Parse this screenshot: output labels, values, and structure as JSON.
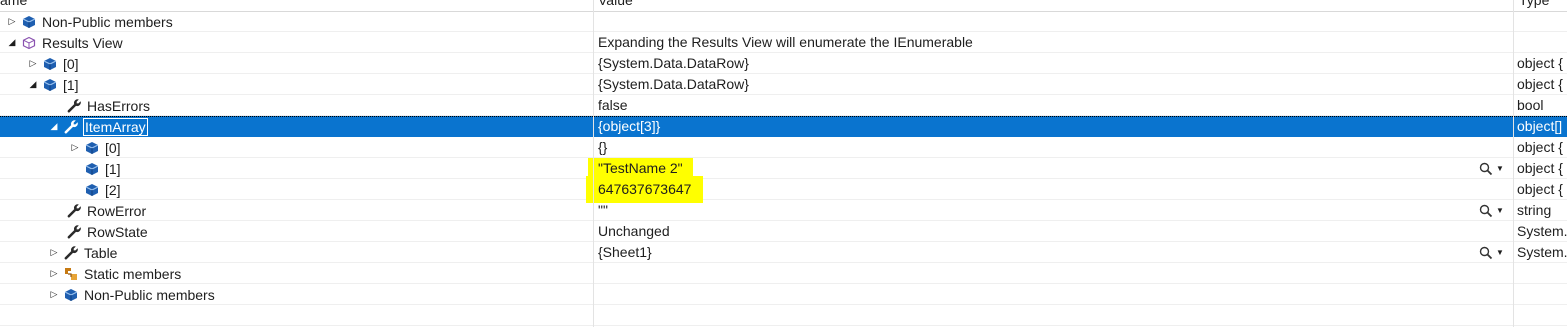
{
  "columns": {
    "name": "ame",
    "value": "Value",
    "type": "Type"
  },
  "rows": [
    {
      "label": "Non-Public members",
      "value": "",
      "type": ""
    },
    {
      "label": "Results View",
      "value": "Expanding the Results View will enumerate the IEnumerable",
      "type": ""
    },
    {
      "label": "[0]",
      "value": "{System.Data.DataRow}",
      "type": "object {"
    },
    {
      "label": "[1]",
      "value": "{System.Data.DataRow}",
      "type": "object {"
    },
    {
      "label": "HasErrors",
      "value": "false",
      "type": "bool"
    },
    {
      "label": "ItemArray",
      "value": "{object[3]}",
      "type": "object[]"
    },
    {
      "label": "[0]",
      "value": "{}",
      "type": "object {"
    },
    {
      "label": "[1]",
      "value": "\"TestName 2\"",
      "type": "object {"
    },
    {
      "label": "[2]",
      "value": "647637673647",
      "type": "object {"
    },
    {
      "label": "RowError",
      "value": "\"\"",
      "type": "string"
    },
    {
      "label": "RowState",
      "value": "Unchanged",
      "type": "System."
    },
    {
      "label": "Table",
      "value": "{Sheet1}",
      "type": "System."
    },
    {
      "label": "Static members",
      "value": "",
      "type": ""
    },
    {
      "label": "Non-Public members",
      "value": "",
      "type": ""
    }
  ],
  "icons": {
    "field": "blue-cube-icon",
    "property": "wrench-icon",
    "results": "results-view-icon",
    "static": "static-members-icon",
    "search": "magnifier-icon"
  },
  "colors": {
    "selection": "#0a74cf",
    "highlight": "#ffff00",
    "field_icon": "#1f5fb0"
  }
}
